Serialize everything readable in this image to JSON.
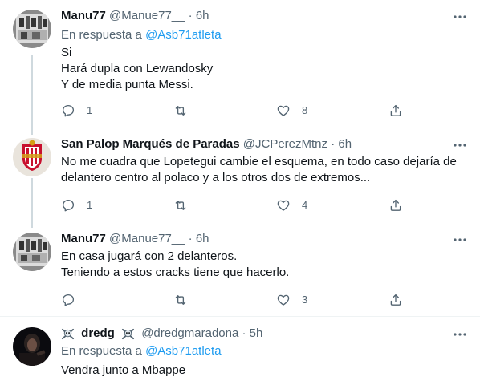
{
  "tweets": [
    {
      "name": "Manu77",
      "handle": "@Manue77__",
      "time": "6h",
      "reply_prefix": "En respuesta a",
      "reply_to": "@Asb71atleta",
      "lines": [
        "Si",
        "Hará dupla con Lewandosky",
        "Y de media punta Messi."
      ],
      "replies": "1",
      "retweets": "",
      "likes": "8"
    },
    {
      "name": "San Palop Marqués de Paradas",
      "handle": "@JCPerezMtnz",
      "time": "6h",
      "lines": [
        "No me cuadra que Lopetegui cambie el esquema, en todo caso dejaría de",
        "delantero centro al polaco y a los otros dos de extremos..."
      ],
      "replies": "1",
      "retweets": "",
      "likes": "4"
    },
    {
      "name": "Manu77",
      "handle": "@Manue77__",
      "time": "6h",
      "lines": [
        "En casa jugará con 2 delanteros.",
        "Teniendo a estos cracks tiene que hacerlo."
      ],
      "replies": "",
      "retweets": "",
      "likes": "3"
    },
    {
      "name": "dredg",
      "handle": "@dredgmaradona",
      "time": "5h",
      "reply_prefix": "En respuesta a",
      "reply_to": "@Asb71atleta",
      "lines": [
        "Vendra junto a Mbappe"
      ]
    }
  ],
  "common": {
    "dot": "·"
  },
  "colors": {
    "link": "#1d9bf0",
    "secondary": "#536471",
    "text": "#0f1419",
    "thread_line": "#cfd9de"
  },
  "icons": {
    "reply": "reply-icon",
    "retweet": "retweet-icon",
    "like": "heart-icon",
    "share": "share-icon",
    "more": "more-icon"
  }
}
